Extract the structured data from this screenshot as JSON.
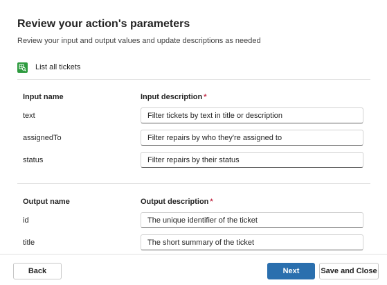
{
  "header": {
    "title": "Review your action's parameters",
    "subtitle": "Review your input and output values and update descriptions as needed"
  },
  "action": {
    "icon": "search-table-icon",
    "label": "List all tickets",
    "icon_color": "#2e9b3f"
  },
  "inputs": {
    "name_header": "Input name",
    "description_header": "Input description",
    "required_marker": "*",
    "rows": [
      {
        "name": "text",
        "description": "Filter tickets by text in title or description"
      },
      {
        "name": "assignedTo",
        "description": "Filter repairs by who they're assigned to"
      },
      {
        "name": "status",
        "description": "Filter repairs by their status"
      }
    ]
  },
  "outputs": {
    "name_header": "Output name",
    "description_header": "Output description",
    "required_marker": "*",
    "rows": [
      {
        "name": "id",
        "description": "The unique identifier of the ticket"
      },
      {
        "name": "title",
        "description": "The short summary of the ticket"
      }
    ]
  },
  "footer": {
    "back_label": "Back",
    "next_label": "Next",
    "save_label": "Save and Close",
    "primary_color": "#2a6fae"
  }
}
